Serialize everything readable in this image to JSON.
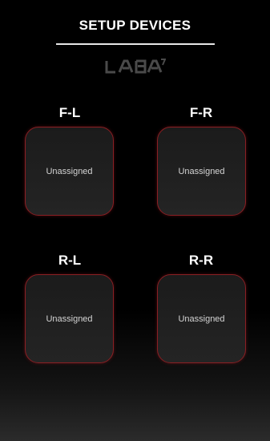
{
  "header": {
    "title": "SETUP DEVICES"
  },
  "brand": {
    "logo_text": "LABA7",
    "logo_color": "#4a4a4a"
  },
  "colors": {
    "background": "#000000",
    "slot_border": "#8a1f23",
    "slot_fill": "#1f1f1f",
    "slot_text": "#d4d4d4"
  },
  "slots": [
    {
      "label": "F-L",
      "status": "Unassigned"
    },
    {
      "label": "F-R",
      "status": "Unassigned"
    },
    {
      "label": "R-L",
      "status": "Unassigned"
    },
    {
      "label": "R-R",
      "status": "Unassigned"
    }
  ]
}
